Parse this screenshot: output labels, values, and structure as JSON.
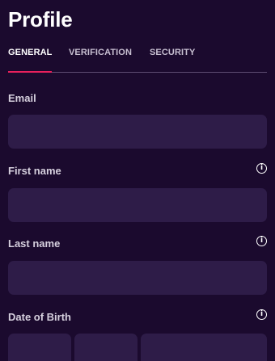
{
  "page": {
    "title": "Profile"
  },
  "tabs": [
    {
      "label": "GENERAL",
      "active": true
    },
    {
      "label": "VERIFICATION",
      "active": false
    },
    {
      "label": "SECURITY",
      "active": false
    }
  ],
  "form": {
    "email": {
      "label": "Email",
      "value": "",
      "placeholder": ""
    },
    "first_name": {
      "label": "First name",
      "value": "",
      "placeholder": "",
      "info_icon": "info-icon"
    },
    "last_name": {
      "label": "Last name",
      "value": "",
      "placeholder": "",
      "info_icon": "info-icon"
    },
    "date_of_birth": {
      "label": "Date of Birth",
      "info_icon": "info-icon",
      "day": {
        "value": "",
        "placeholder": ""
      },
      "month": {
        "value": "",
        "placeholder": ""
      },
      "year": {
        "value": "",
        "placeholder": ""
      }
    }
  },
  "colors": {
    "background": "#1b0a2e",
    "input_background": "#2e1c48",
    "tab_indicator": "#e8205c",
    "divider": "#5e4d72",
    "label": "#d6d0de"
  }
}
